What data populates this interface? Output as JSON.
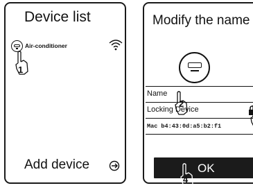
{
  "device_list": {
    "title": "Device  list",
    "device_name": "Air-conditioner",
    "step": "1",
    "add_label": "Add device"
  },
  "modify": {
    "title": "Modify the name",
    "rows": [
      {
        "label": "Name",
        "step": "2"
      },
      {
        "label": "Locking Device",
        "step": "3"
      },
      {
        "label": "Mac b4:43:0d:a5:b2:f1"
      }
    ],
    "ok_label": "OK",
    "ok_step": "4"
  },
  "icons": [
    "air-conditioner-icon",
    "wifi-icon",
    "pointing-hand-icon",
    "arrow-circle-icon",
    "lock-icon"
  ]
}
